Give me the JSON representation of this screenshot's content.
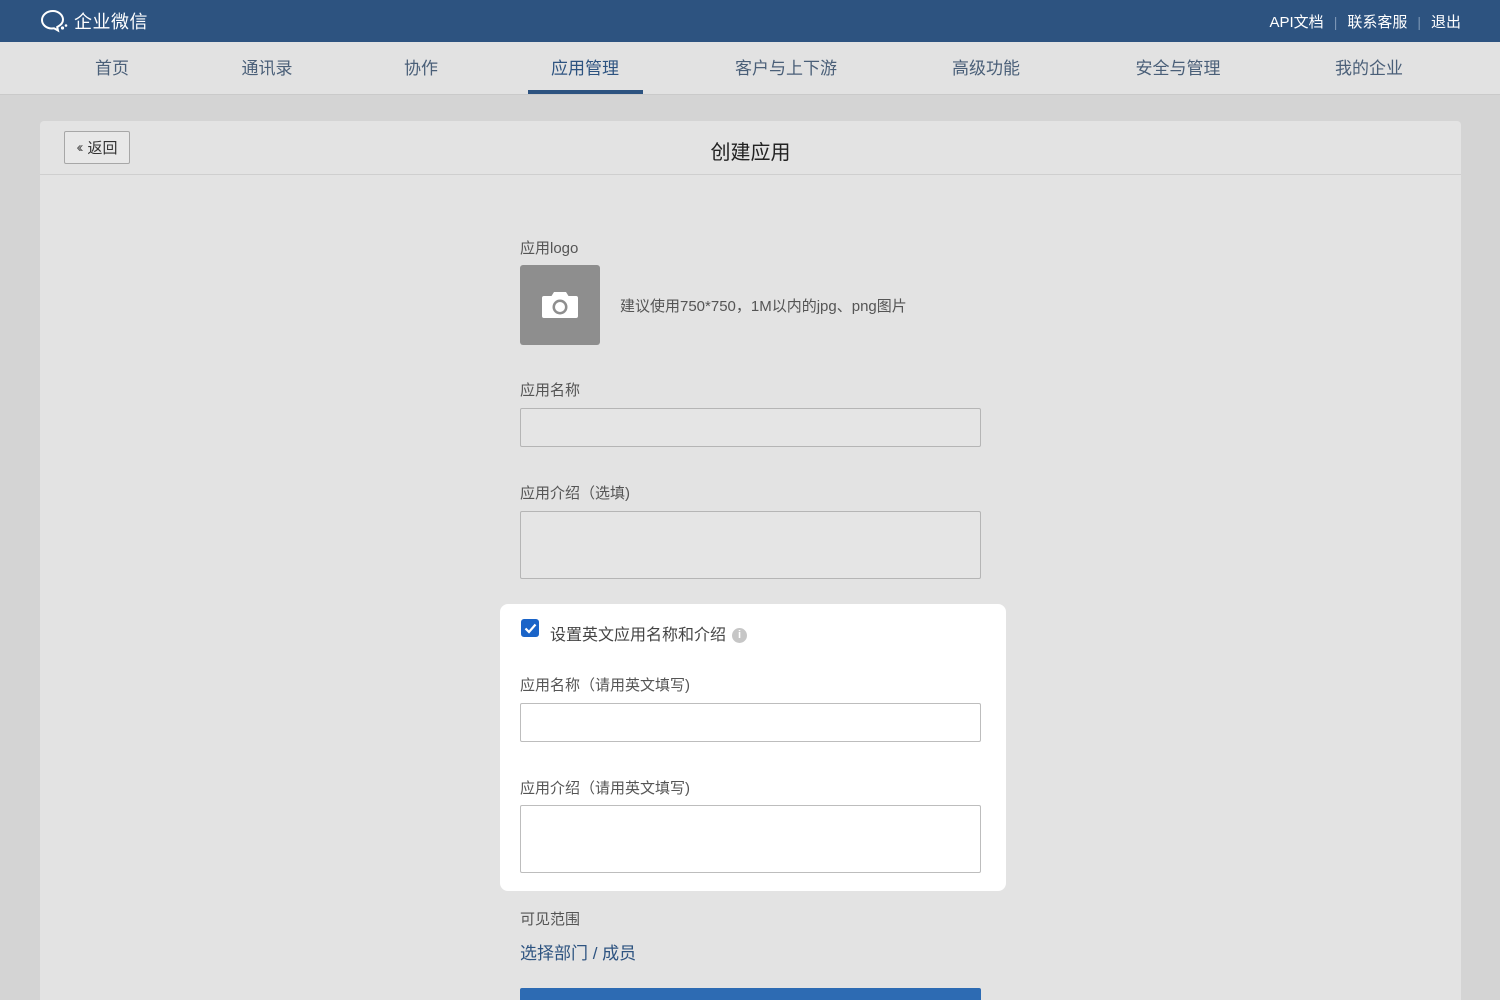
{
  "topbar": {
    "brand": "企业微信",
    "links": [
      "API文档",
      "联系客服",
      "退出"
    ]
  },
  "nav": {
    "items": [
      "首页",
      "通讯录",
      "协作",
      "应用管理",
      "客户与上下游",
      "高级功能",
      "安全与管理",
      "我的企业"
    ],
    "active": "应用管理"
  },
  "panel": {
    "back_label": "返回",
    "title": "创建应用"
  },
  "form": {
    "logo_label": "应用logo",
    "logo_hint": "建议使用750*750，1M以内的jpg、png图片",
    "name_label": "应用名称",
    "name_value": "",
    "intro_label": "应用介绍（选填)",
    "intro_value": "",
    "english_toggle": {
      "checked": true,
      "label": "设置英文应用名称和介绍"
    },
    "en_name_label": "应用名称（请用英文填写)",
    "en_name_value": "",
    "en_intro_label": "应用介绍（请用英文填写)",
    "en_intro_value": "",
    "visibility_label": "可见范围",
    "visibility_link": "选择部门 / 成员"
  },
  "colors": {
    "topbar": "#2d5380",
    "accent": "#1a64c8",
    "link": "#2d5380"
  }
}
